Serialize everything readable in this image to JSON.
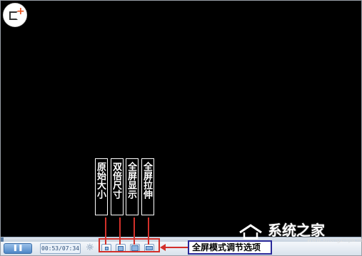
{
  "player": {
    "time_display": "00:53/07:34",
    "play_icon": "pause-icon",
    "settings_icon": "brightness-icon"
  },
  "display_modes": [
    {
      "label": "原始大小",
      "icon": "original-size-icon"
    },
    {
      "label": "双倍尺寸",
      "icon": "double-size-icon"
    },
    {
      "label": "全屏显示",
      "icon": "fullscreen-display-icon"
    },
    {
      "label": "全屏拉伸",
      "icon": "fullscreen-stretch-icon"
    }
  ],
  "callout": {
    "text": "全屏模式调节选项"
  },
  "watermark": {
    "text": "系统之家",
    "url": "www.xitongzhijia.net"
  },
  "colors": {
    "highlight_red": "#d3302a",
    "callout_border": "#2a2a9a",
    "video_background": "#000000"
  }
}
